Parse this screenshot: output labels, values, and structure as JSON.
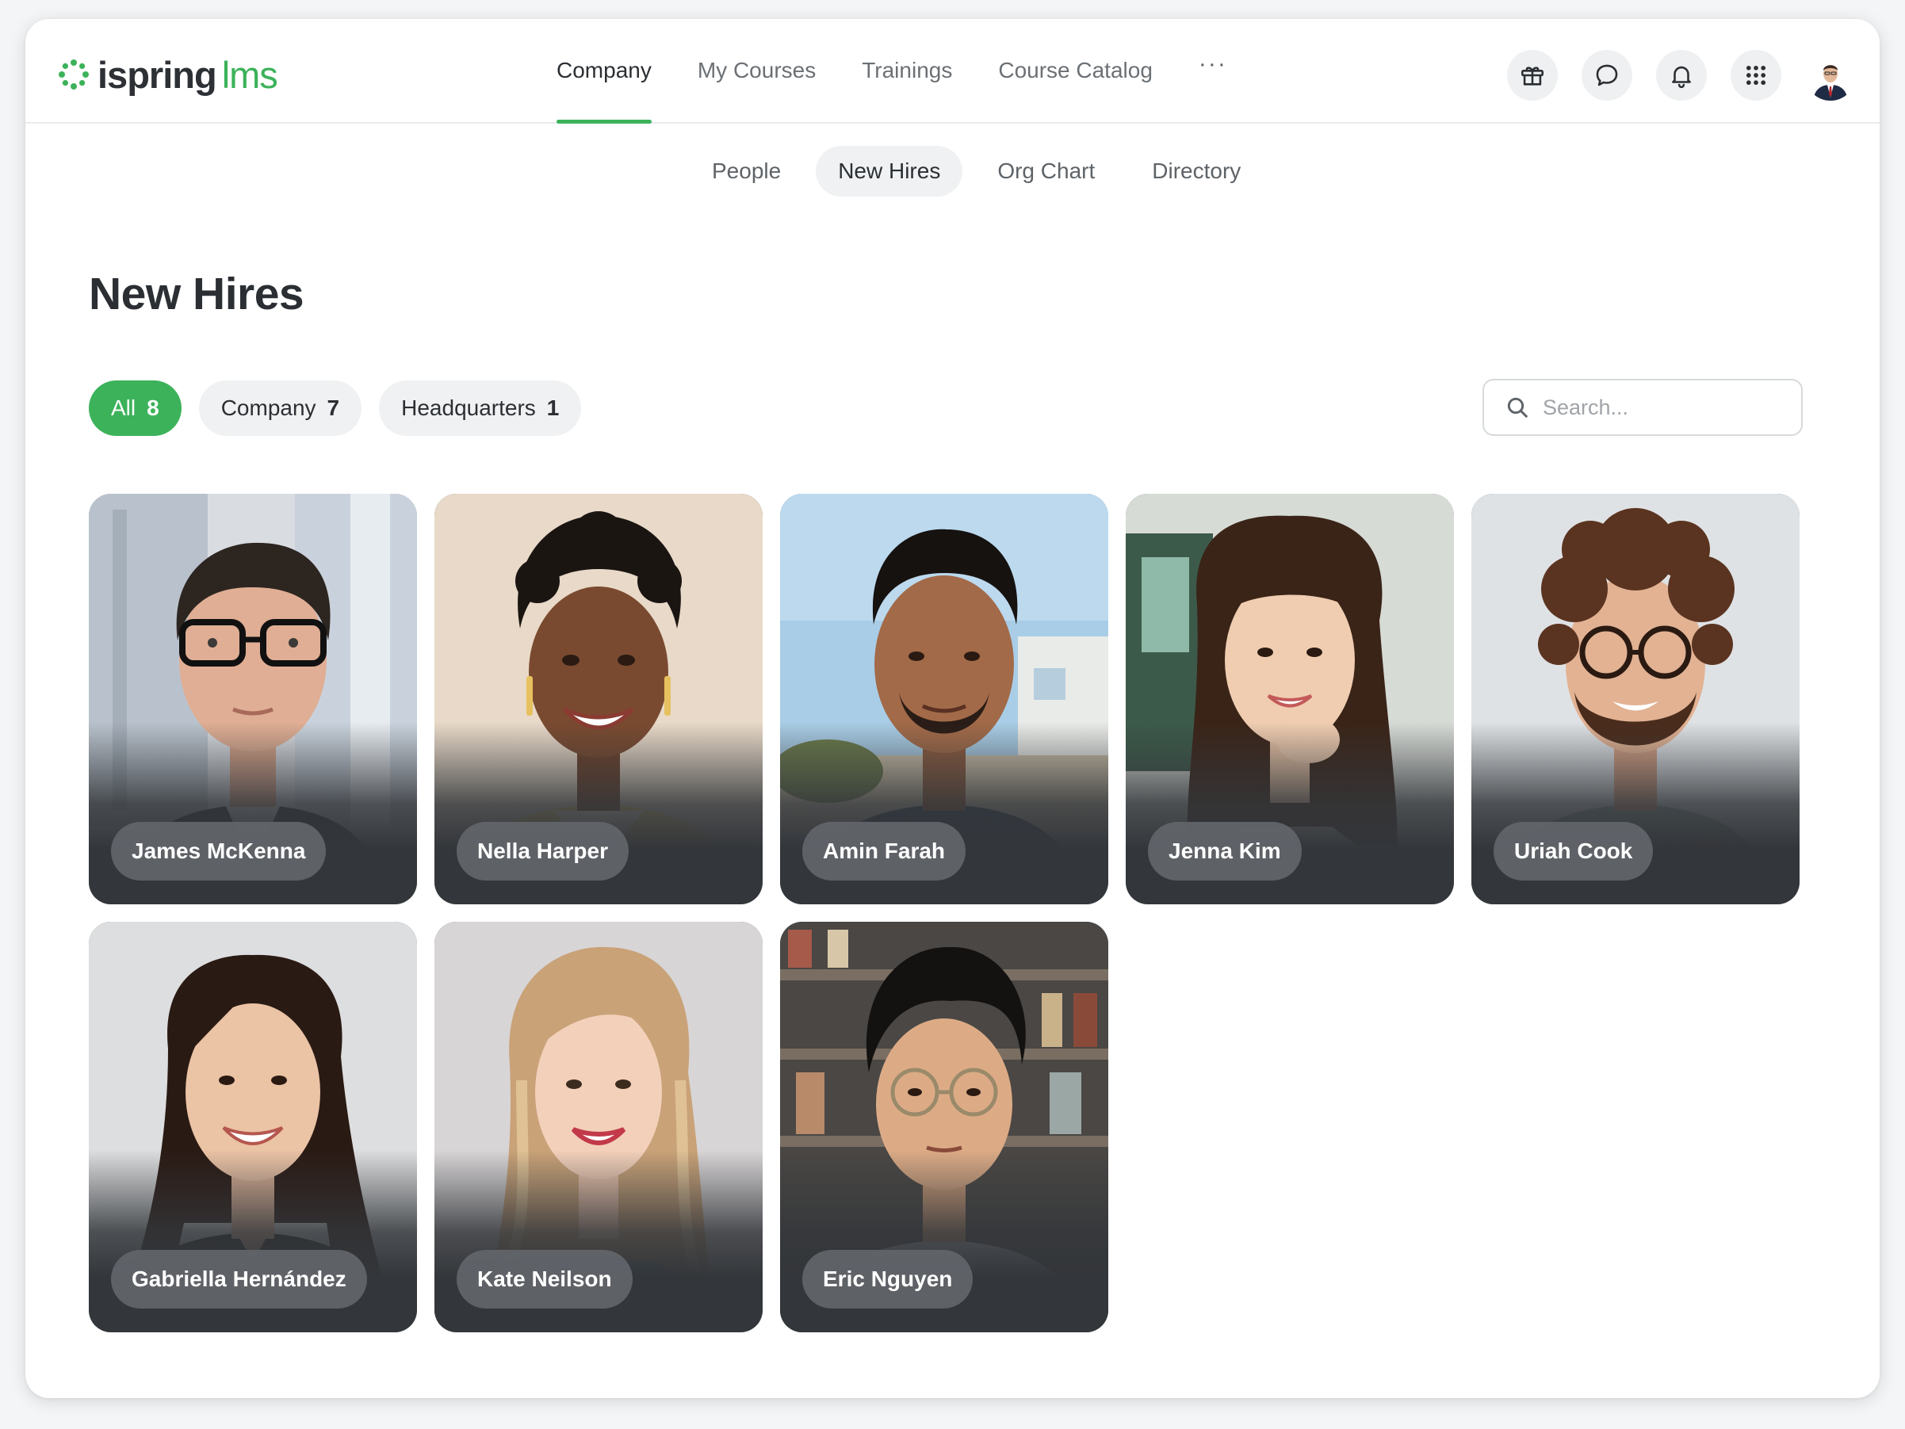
{
  "brand": {
    "name_bold": "ispring",
    "name_light": "lms",
    "accent": "#3cb25a"
  },
  "nav": {
    "items": [
      {
        "label": "Company",
        "active": true
      },
      {
        "label": "My Courses",
        "active": false
      },
      {
        "label": "Trainings",
        "active": false
      },
      {
        "label": "Course Catalog",
        "active": false
      }
    ],
    "more_label": "···"
  },
  "top_actions": [
    "gift-icon",
    "chat-icon",
    "bell-icon",
    "apps-grid-icon",
    "user-avatar"
  ],
  "subtabs": [
    {
      "label": "People",
      "active": false
    },
    {
      "label": "New Hires",
      "active": true
    },
    {
      "label": "Org Chart",
      "active": false
    },
    {
      "label": "Directory",
      "active": false
    }
  ],
  "page": {
    "title": "New Hires"
  },
  "filters": [
    {
      "label": "All",
      "count": "8",
      "active": true
    },
    {
      "label": "Company",
      "count": "7",
      "active": false
    },
    {
      "label": "Headquarters",
      "count": "1",
      "active": false
    }
  ],
  "search": {
    "placeholder": "Search..."
  },
  "people": [
    {
      "name": "James McKenna"
    },
    {
      "name": "Nella Harper"
    },
    {
      "name": "Amin Farah"
    },
    {
      "name": "Jenna Kim"
    },
    {
      "name": "Uriah Cook"
    },
    {
      "name": "Gabriella Hernández"
    },
    {
      "name": "Kate Neilson"
    },
    {
      "name": "Eric Nguyen"
    }
  ]
}
